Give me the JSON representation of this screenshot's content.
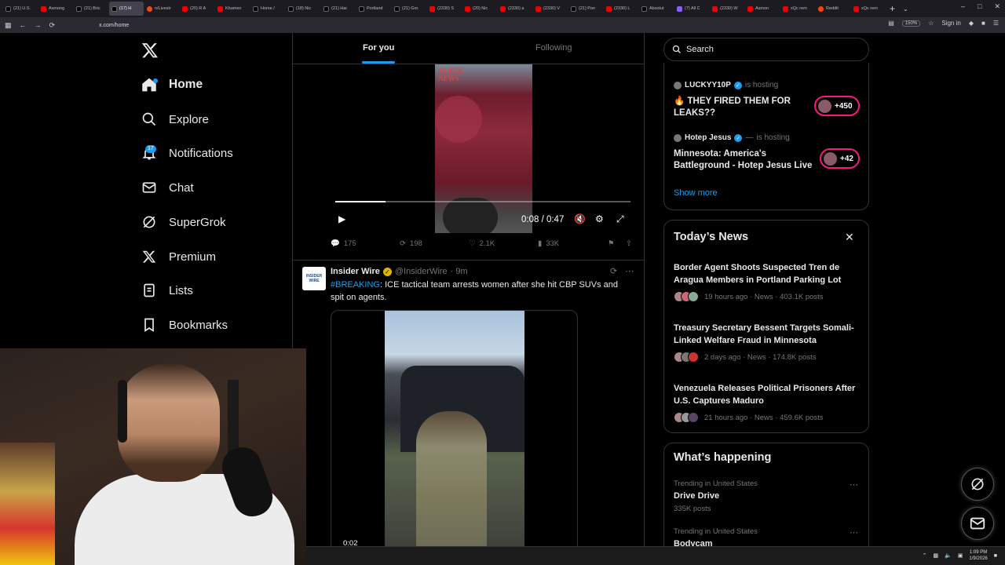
{
  "browser": {
    "tabs": [
      "(21) U.S.",
      "Asmong",
      "(21) Bric",
      "(17) H",
      "n/Livestr",
      "(20) R A",
      "Khamen",
      "Home /",
      "(18) Nic",
      "(21) Har",
      "Portland",
      "(21) Gro",
      "(2330) S",
      "(20) Nic",
      "(2330) a",
      "(2330) V",
      "(21) Pon",
      "(2330) L",
      "Absolut",
      "(7) All C",
      "(2330) W",
      "Asmon",
      "xQc rem",
      "Reddit",
      "xQc rem"
    ],
    "url": "x.com/home",
    "zoom": "150%",
    "sign_in": "Sign in"
  },
  "nav": {
    "home": "Home",
    "explore": "Explore",
    "notifications": "Notifications",
    "notifications_badge": "17",
    "chat": "Chat",
    "supergrok": "SuperGrok",
    "premium": "Premium",
    "lists": "Lists",
    "bookmarks": "Bookmarks"
  },
  "timeline_tabs": {
    "for_you": "For you",
    "following": "Following"
  },
  "post1": {
    "watermark_line1": "ALPHA",
    "watermark_line2": "NEWS",
    "video_time": "0:08 / 0:47",
    "progress": 0.17,
    "replies": "175",
    "reposts": "198",
    "likes": "2.1K",
    "views": "33K"
  },
  "post2": {
    "avatar_line1": "INSIDER",
    "avatar_line2": "WIRE",
    "name": "Insider Wire",
    "handle": "@InsiderWire",
    "time": "· 9m",
    "hashtag": "#BREAKING",
    "text": ": ICE tactical team arrests women after she hit CBP SUVs and spit on agents.",
    "video_time": "0:02"
  },
  "search": {
    "placeholder": "Search"
  },
  "live": {
    "host1_name": "LUCKYY10P",
    "host1_suffix": "is hosting",
    "host1_title": "THEY FIRED THEM FOR LEAKS??",
    "host1_emoji": "🔥",
    "host1_count": "+450",
    "host2_name": "Hotep Jesus",
    "host2_sep": "—",
    "host2_suffix": "is hosting",
    "host2_title": "Minnesota: America's Battleground - Hotep Jesus Live",
    "host2_count": "+42",
    "show_more": "Show more"
  },
  "news": {
    "title": "Today’s News",
    "items": [
      {
        "title": "Border Agent Shoots Suspected Tren de Aragua Members in Portland Parking Lot",
        "meta": "19 hours ago · News · 403.1K posts"
      },
      {
        "title": "Treasury Secretary Bessent Targets Somali-Linked Welfare Fraud in Minnesota",
        "meta": "2 days ago · News · 174.8K posts"
      },
      {
        "title": "Venezuela Releases Political Prisoners After U.S. Captures Maduro",
        "meta": "21 hours ago · News · 459.6K posts"
      }
    ]
  },
  "happening": {
    "title": "What’s happening",
    "trends": [
      {
        "category": "Trending in United States",
        "name": "Drive Drive",
        "count": "335K posts"
      },
      {
        "category": "Trending in United States",
        "name": "Bodycam",
        "count": ""
      }
    ]
  },
  "taskbar": {
    "time": "1:09 PM",
    "date": "1/9/2026"
  },
  "colors": {
    "accent": "#1d9bf0",
    "live": "#f91880",
    "border": "#2f3336",
    "muted": "#71767b"
  }
}
